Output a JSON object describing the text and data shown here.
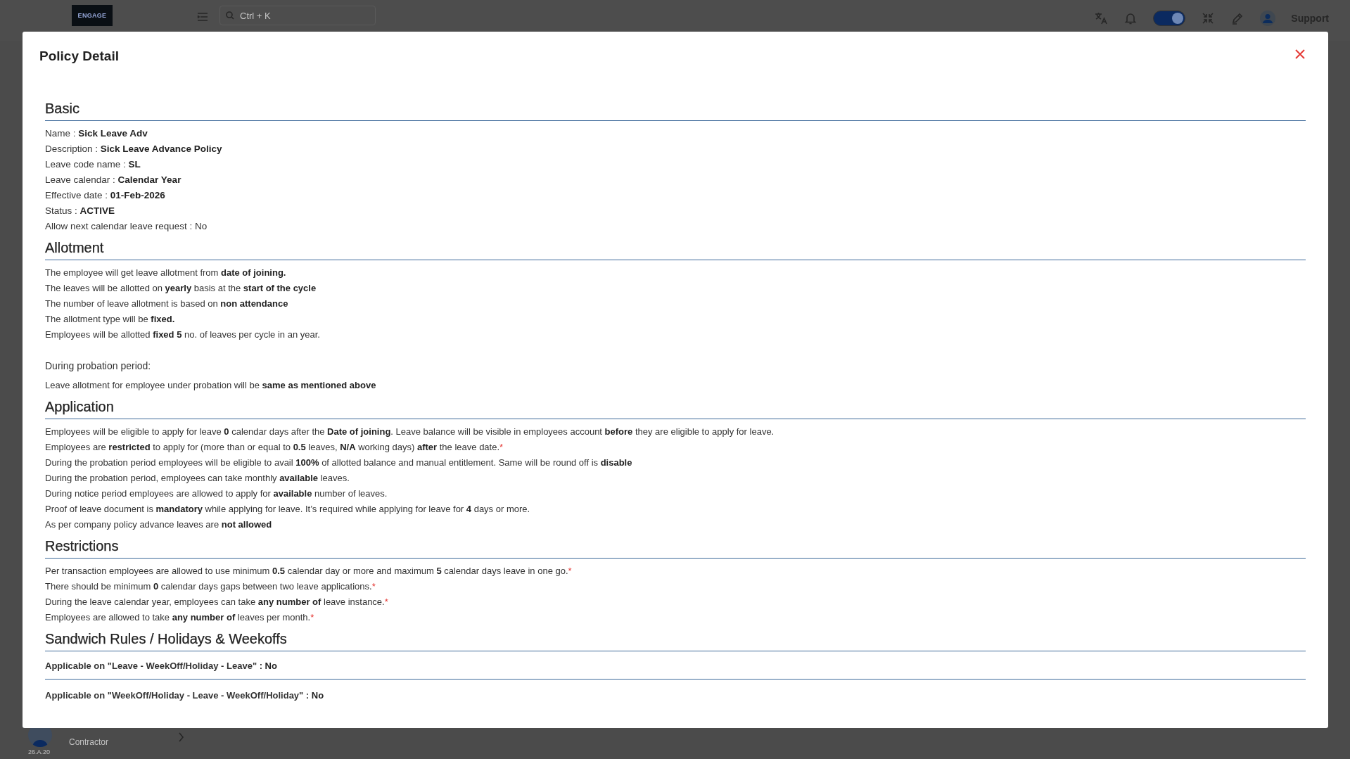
{
  "topbar": {
    "logo": "ENGAGE",
    "search": {
      "placeholder": "Ctrl + K"
    },
    "theme_toggle": {
      "on": true
    },
    "support": "Support"
  },
  "sidebar_footer": {
    "version": "26.A.20",
    "role": "Contractor"
  },
  "modal": {
    "title": "Policy Detail",
    "sections": [
      {
        "heading": "Basic",
        "lines": [
          {
            "kind": "line",
            "text": "Name : **Sick Leave Adv**"
          },
          {
            "kind": "line",
            "text": "Description : **Sick Leave Advance Policy**"
          },
          {
            "kind": "line",
            "text": "Leave code name : **SL**"
          },
          {
            "kind": "line",
            "text": "Leave calendar : **Calendar Year**"
          },
          {
            "kind": "line",
            "text": "Effective date : **01-Feb-2026**"
          },
          {
            "kind": "line",
            "text": "Status : **ACTIVE**"
          },
          {
            "kind": "line",
            "text": "Allow next calendar leave request : No"
          }
        ]
      },
      {
        "heading": "Allotment",
        "lines": [
          {
            "kind": "line",
            "text": "The employee will get leave allotment from **date of joining.**"
          },
          {
            "kind": "line",
            "text": "The leaves will be allotted on **yearly** basis at the **start of the cycle**"
          },
          {
            "kind": "line",
            "text": "The number of leave allotment is based on **non attendance**"
          },
          {
            "kind": "line",
            "text": "The allotment type will be **fixed.**"
          },
          {
            "kind": "line",
            "text": "Employees will be allotted **fixed 5** no. of leaves per cycle in an year."
          },
          {
            "kind": "subheading",
            "text": "During probation period:"
          },
          {
            "kind": "line",
            "text": "Leave allotment for employee under probation will be **same as mentioned above**"
          }
        ]
      },
      {
        "heading": "Application",
        "lines": [
          {
            "kind": "line",
            "text": "Employees will be eligible to apply for leave **0** calendar days after the **Date of joining**. Leave balance will be visible in employees account **before** they are eligible to apply for leave."
          },
          {
            "kind": "line",
            "text": "Employees are **restricted** to apply for (more than or equal to **0.5** leaves, **N/A** working days) **after** the leave date.",
            "suffix": "*"
          },
          {
            "kind": "line",
            "text": "During the probation period employees will be eligible to avail **100%** of allotted balance and manual entitlement. Same will be round off is **disable**"
          },
          {
            "kind": "line",
            "text": "During the probation period, employees can take monthly **available** leaves."
          },
          {
            "kind": "line",
            "text": "During notice period employees are allowed to apply for **available** number of leaves."
          },
          {
            "kind": "line",
            "text": "Proof of leave document is **mandatory** while applying for leave. It’s required while applying for leave for **4** days or more."
          },
          {
            "kind": "line",
            "text": "As per company policy advance leaves are **not allowed**"
          }
        ]
      },
      {
        "heading": "Restrictions",
        "lines": [
          {
            "kind": "line",
            "text": "Per transaction employees are allowed to use minimum **0.5** calendar day or more and maximum **5** calendar days leave in one go.",
            "suffix": "*"
          },
          {
            "kind": "line",
            "text": "There should be minimum **0** calendar days gaps between two leave applications.",
            "suffix": "*"
          },
          {
            "kind": "line",
            "text": "During the leave calendar year, employees can take **any number of** leave instance.",
            "suffix": "*"
          },
          {
            "kind": "line",
            "text": "Employees are allowed to take **any number of** leaves per month.",
            "suffix": "*"
          }
        ]
      },
      {
        "heading": "Sandwich Rules / Holidays & Weekoffs",
        "lines": [
          {
            "kind": "rule",
            "text": "Applicable on \"Leave - WeekOff/Holiday - Leave\" : **No**"
          },
          {
            "kind": "rule",
            "text": "Applicable on \"WeekOff/Holiday - Leave - WeekOff/Holiday\" : **No**"
          }
        ]
      }
    ]
  }
}
